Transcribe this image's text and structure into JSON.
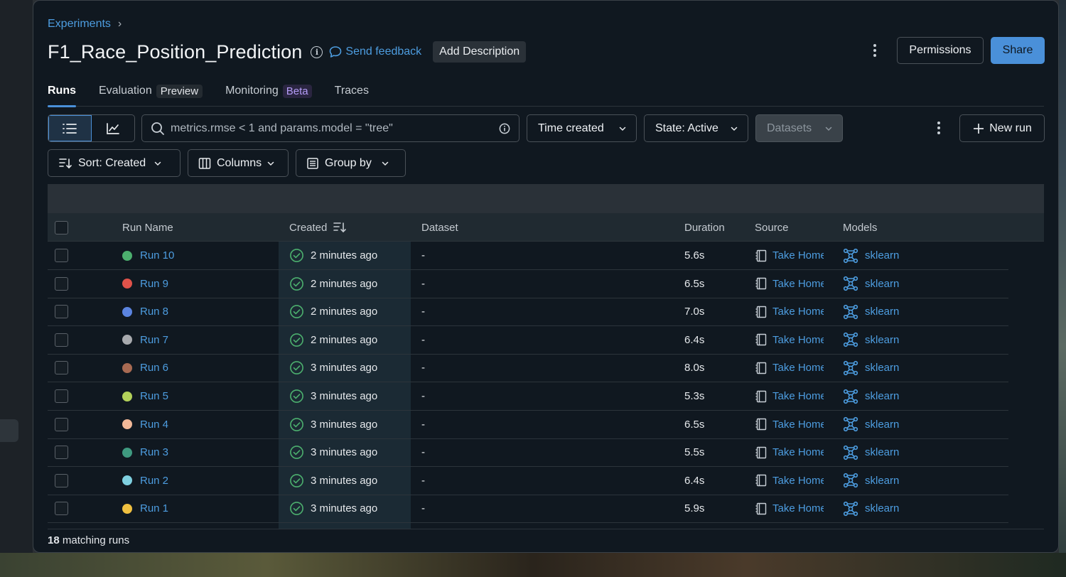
{
  "breadcrumb": {
    "parent": "Experiments"
  },
  "header": {
    "title": "F1_Race_Position_Prediction",
    "feedback_label": "Send feedback",
    "add_description_label": "Add Description",
    "permissions_label": "Permissions",
    "share_label": "Share"
  },
  "tabs": [
    {
      "label": "Runs",
      "tag": ""
    },
    {
      "label": "Evaluation",
      "tag": "Preview"
    },
    {
      "label": "Monitoring",
      "tag": "Beta"
    },
    {
      "label": "Traces",
      "tag": ""
    }
  ],
  "toolbar": {
    "search_placeholder": "metrics.rmse < 1 and params.model = \"tree\"",
    "time_created_label": "Time created",
    "state_label": "State: Active",
    "datasets_label": "Datasets",
    "new_run_label": "New run",
    "sort_label": "Sort: Created",
    "columns_label": "Columns",
    "group_by_label": "Group by"
  },
  "table": {
    "columns": {
      "run_name": "Run Name",
      "created": "Created",
      "dataset": "Dataset",
      "duration": "Duration",
      "source": "Source",
      "models": "Models"
    },
    "rows": [
      {
        "name": "Run 10",
        "color": "#4caf6e",
        "created": "2 minutes ago",
        "dataset": "-",
        "duration": "5.6s",
        "source": "Take Home",
        "model": "sklearn"
      },
      {
        "name": "Run 9",
        "color": "#e0524a",
        "created": "2 minutes ago",
        "dataset": "-",
        "duration": "6.5s",
        "source": "Take Home",
        "model": "sklearn"
      },
      {
        "name": "Run 8",
        "color": "#5b84e0",
        "created": "2 minutes ago",
        "dataset": "-",
        "duration": "7.0s",
        "source": "Take Home",
        "model": "sklearn"
      },
      {
        "name": "Run 7",
        "color": "#a8aaae",
        "created": "2 minutes ago",
        "dataset": "-",
        "duration": "6.4s",
        "source": "Take Home",
        "model": "sklearn"
      },
      {
        "name": "Run 6",
        "color": "#a86a52",
        "created": "3 minutes ago",
        "dataset": "-",
        "duration": "8.0s",
        "source": "Take Home",
        "model": "sklearn"
      },
      {
        "name": "Run 5",
        "color": "#b3d15a",
        "created": "3 minutes ago",
        "dataset": "-",
        "duration": "5.3s",
        "source": "Take Home",
        "model": "sklearn"
      },
      {
        "name": "Run 4",
        "color": "#f2b898",
        "created": "3 minutes ago",
        "dataset": "-",
        "duration": "6.5s",
        "source": "Take Home",
        "model": "sklearn"
      },
      {
        "name": "Run 3",
        "color": "#3f9a80",
        "created": "3 minutes ago",
        "dataset": "-",
        "duration": "5.5s",
        "source": "Take Home",
        "model": "sklearn"
      },
      {
        "name": "Run 2",
        "color": "#7fd0e0",
        "created": "3 minutes ago",
        "dataset": "-",
        "duration": "6.4s",
        "source": "Take Home",
        "model": "sklearn"
      },
      {
        "name": "Run 1",
        "color": "#f0c040",
        "created": "3 minutes ago",
        "dataset": "-",
        "duration": "5.9s",
        "source": "Take Home",
        "model": "sklearn"
      }
    ]
  },
  "footer": {
    "count": "18",
    "suffix": "matching runs"
  },
  "colors": {
    "accent": "#4a90d9",
    "link": "#4d9de0",
    "success": "#4caf6e"
  }
}
